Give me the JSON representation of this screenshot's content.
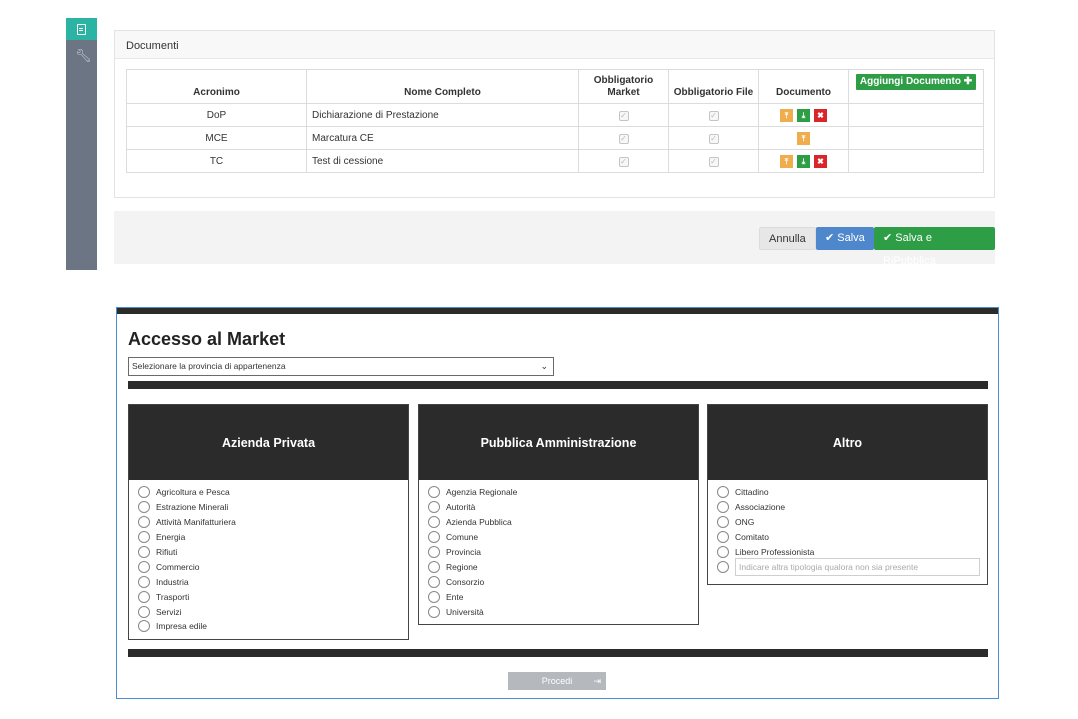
{
  "documents": {
    "panel_title": "Documenti",
    "columns": [
      "Acronimo",
      "Nome Completo",
      "Obbligatorio Market",
      "Obbligatorio File",
      "Documento"
    ],
    "add_button": "Aggiungi Documento",
    "rows": [
      {
        "acronym": "DoP",
        "name": "Dichiarazione di Prestazione"
      },
      {
        "acronym": "MCE",
        "name": "Marcatura CE"
      },
      {
        "acronym": "TC",
        "name": "Test di cessione"
      }
    ],
    "buttons": {
      "cancel": "Annulla",
      "save": "Salva",
      "save_republish": "Salva e RiPubblica"
    }
  },
  "market": {
    "title": "Accesso al Market",
    "select_placeholder": "Selezionare la provincia di appartenenza",
    "columns": [
      {
        "title": "Azienda Privata",
        "options": [
          "Agricoltura e Pesca",
          "Estrazione Minerali",
          "Attività Manifatturiera",
          "Energia",
          "Rifiuti",
          "Commercio",
          "Industria",
          "Trasporti",
          "Servizi",
          "Impresa edile"
        ]
      },
      {
        "title": "Pubblica Amministrazione",
        "options": [
          "Agenzia Regionale",
          "Autorità",
          "Azienda Pubblica",
          "Comune",
          "Provincia",
          "Regione",
          "Consorzio",
          "Ente",
          "Università"
        ]
      },
      {
        "title": "Altro",
        "options": [
          "Cittadino",
          "Associazione",
          "ONG",
          "Comitato",
          "Libero Professionista"
        ],
        "other_placeholder": "Indicare altra tipologia qualora non sia presente"
      }
    ],
    "proceed_button": "Procedi"
  },
  "colors": {
    "accent_teal": "#2bb3a3",
    "success": "#2e9e46",
    "primary": "#4f87cd",
    "warning": "#f0ad4e",
    "danger": "#d9262b"
  }
}
